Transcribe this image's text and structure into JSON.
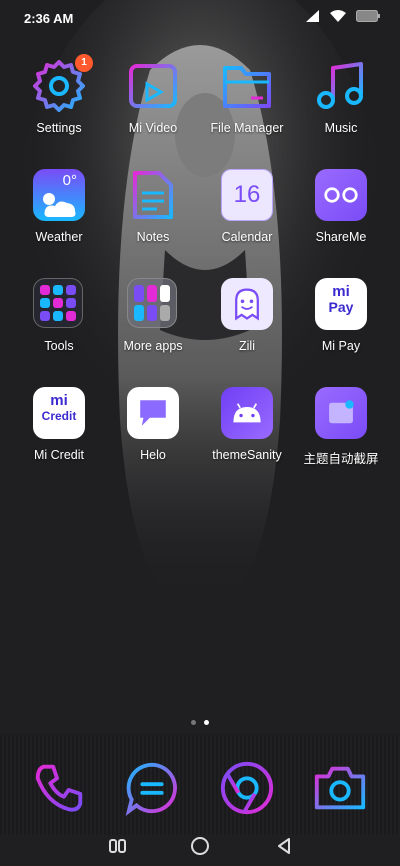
{
  "status": {
    "time": "2:36 AM"
  },
  "apps": [
    {
      "label": "Settings",
      "icon": "gear-icon",
      "badge": "1"
    },
    {
      "label": "Mi Video",
      "icon": "video-icon"
    },
    {
      "label": "File Manager",
      "icon": "folder-icon"
    },
    {
      "label": "Music",
      "icon": "music-icon"
    },
    {
      "label": "Weather",
      "icon": "weather-icon",
      "temp": "0°"
    },
    {
      "label": "Notes",
      "icon": "notes-icon"
    },
    {
      "label": "Calendar",
      "icon": "calendar-icon",
      "day": "16"
    },
    {
      "label": "ShareMe",
      "icon": "shareme-icon"
    },
    {
      "label": "Tools",
      "icon": "tools-folder-icon"
    },
    {
      "label": "More apps",
      "icon": "more-apps-folder-icon"
    },
    {
      "label": "Zili",
      "icon": "zili-icon"
    },
    {
      "label": "Mi Pay",
      "icon": "mipay-icon",
      "text": "Pay"
    },
    {
      "label": "Mi Credit",
      "icon": "micredit-icon",
      "text": "Credit"
    },
    {
      "label": "Helo",
      "icon": "helo-icon"
    },
    {
      "label": "themeSanity",
      "icon": "android-icon"
    },
    {
      "label": "主题自动截屏",
      "icon": "screenshot-icon"
    }
  ],
  "pages": {
    "count": 2,
    "active": 2
  },
  "dock": [
    "phone-icon",
    "messages-icon",
    "chrome-icon",
    "camera-icon"
  ],
  "nav": [
    "recents-icon",
    "home-icon",
    "back-icon"
  ],
  "colors": {
    "accent_magenta": "#e22bd6",
    "accent_cyan": "#19b8ff",
    "accent_purple": "#7a4cf6"
  }
}
